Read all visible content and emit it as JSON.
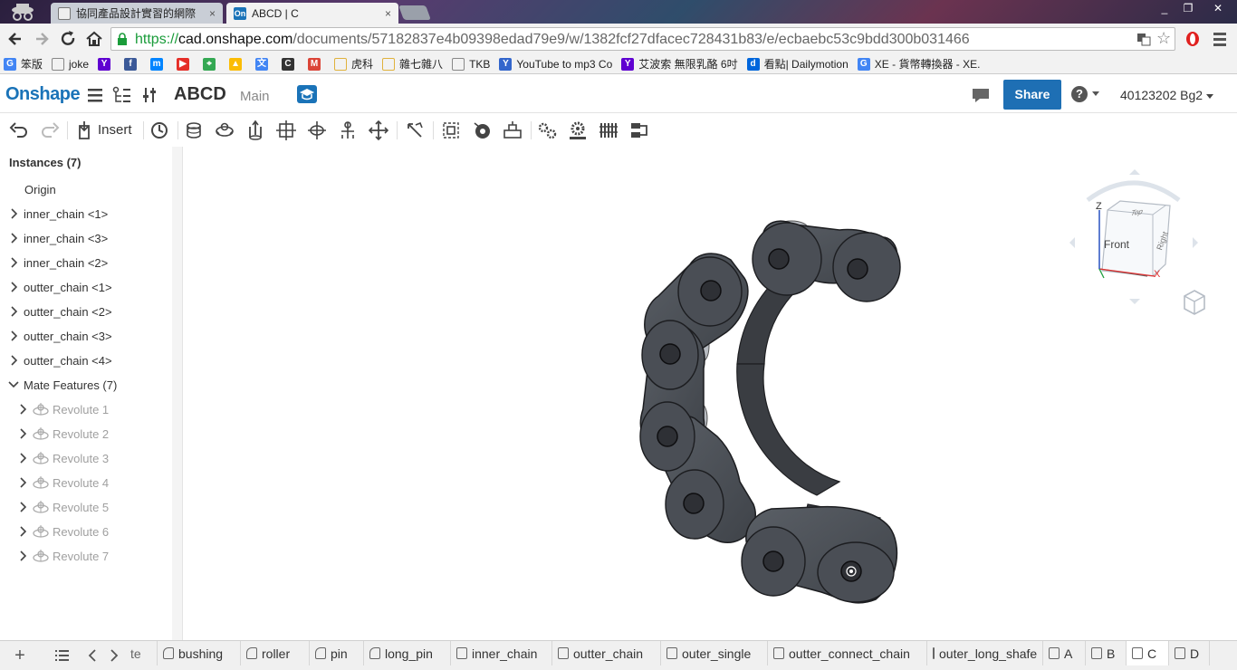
{
  "browser": {
    "tabs": [
      {
        "title": "協同產品設計實習的網際",
        "close": "×"
      },
      {
        "title": "ABCD | C",
        "close": "×"
      }
    ],
    "window_controls": {
      "minimize": "_",
      "restore": "❐",
      "close": "✕"
    },
    "url": {
      "scheme": "https://",
      "domain": "cad.onshape.com",
      "path": "/documents/57182837e4b09398edad79e9/w/1382fcf27dfacec728431b83/e/ecbaebc53c9bdd300b031466"
    },
    "bookmarks": [
      {
        "label": "笨版",
        "icon": "G",
        "color": "#4285f4"
      },
      {
        "label": "joke",
        "icon": "",
        "color": "#888888"
      },
      {
        "label": "",
        "icon": "Y",
        "color": "#5f01d1"
      },
      {
        "label": "",
        "icon": "f",
        "color": "#3b5998"
      },
      {
        "label": "",
        "icon": "m",
        "color": "#0084ff"
      },
      {
        "label": "",
        "icon": "▶",
        "color": "#e52d27"
      },
      {
        "label": "",
        "icon": "⌖",
        "color": "#34a853"
      },
      {
        "label": "",
        "icon": "▲",
        "color": "#fbbc05"
      },
      {
        "label": "",
        "icon": "文",
        "color": "#4285f4"
      },
      {
        "label": "",
        "icon": "C",
        "color": "#333333"
      },
      {
        "label": "",
        "icon": "M",
        "color": "#db4437"
      },
      {
        "label": "虎科",
        "icon": "",
        "color": "#e0b23c"
      },
      {
        "label": "雜七雜八",
        "icon": "",
        "color": "#e0b23c"
      },
      {
        "label": "TKB",
        "icon": "",
        "color": "#888888"
      },
      {
        "label": "YouTube to mp3 Co",
        "icon": "Y",
        "color": "#3366cc"
      },
      {
        "label": "艾波索 無限乳酪 6吋",
        "icon": "Y",
        "color": "#5f01d1"
      },
      {
        "label": "看點| Dailymotion",
        "icon": "d",
        "color": "#0066dc"
      },
      {
        "label": "XE - 貨幣轉換器 - XE.",
        "icon": "G",
        "color": "#4285f4"
      }
    ]
  },
  "app": {
    "logo": "Onshape",
    "document_title": "ABCD",
    "branch": "Main",
    "share_label": "Share",
    "help_label": "?",
    "user_label": "40123202 Bg2",
    "toolbar": {
      "insert_label": "Insert"
    }
  },
  "feature_tree": {
    "instances_title": "Instances (7)",
    "origin": "Origin",
    "instances": [
      "inner_chain <1>",
      "inner_chain <3>",
      "inner_chain <2>",
      "outter_chain <1>",
      "outter_chain <2>",
      "outter_chain <3>",
      "outter_chain <4>"
    ],
    "mates_title": "Mate Features (7)",
    "mates": [
      "Revolute 1",
      "Revolute 2",
      "Revolute 3",
      "Revolute 4",
      "Revolute 5",
      "Revolute 6",
      "Revolute 7"
    ]
  },
  "view_cube": {
    "front": "Front",
    "right": "Right",
    "top": "Top",
    "axis_x": "X",
    "axis_z": "Z"
  },
  "element_tabs": [
    {
      "label": "te",
      "icon": "part-studio-icon"
    },
    {
      "label": "bushing",
      "icon": "part-studio-icon"
    },
    {
      "label": "roller",
      "icon": "part-studio-icon"
    },
    {
      "label": "pin",
      "icon": "part-studio-icon"
    },
    {
      "label": "long_pin",
      "icon": "part-studio-icon"
    },
    {
      "label": "inner_chain",
      "icon": "assembly-icon"
    },
    {
      "label": "outter_chain",
      "icon": "assembly-icon"
    },
    {
      "label": "outer_single",
      "icon": "assembly-icon"
    },
    {
      "label": "outter_connect_chain",
      "icon": "assembly-icon"
    },
    {
      "label": "outer_long_shafe",
      "icon": "assembly-icon"
    },
    {
      "label": "A",
      "icon": "assembly-icon"
    },
    {
      "label": "B",
      "icon": "assembly-icon"
    },
    {
      "label": "C",
      "icon": "assembly-icon",
      "active": true
    },
    {
      "label": "D",
      "icon": "assembly-icon"
    }
  ],
  "colors": {
    "brand": "#1a73b8",
    "share": "#1e6fb4",
    "part": "#4a4e55"
  }
}
